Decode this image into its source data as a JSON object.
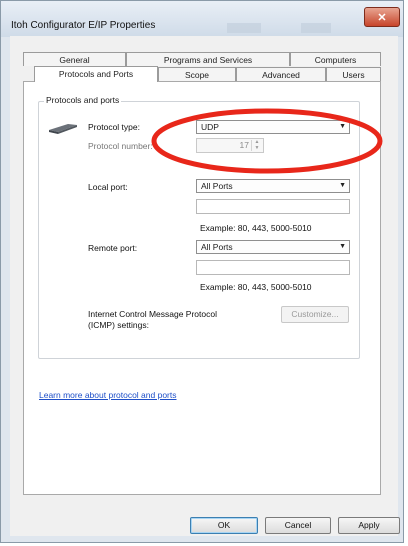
{
  "window": {
    "title": "Itoh Configurator E/IP Properties",
    "close_glyph": "✕",
    "accent_close": "#c7452b"
  },
  "tabs": {
    "row_back": [
      "General",
      "Programs and Services",
      "Computers"
    ],
    "row_front": [
      "Protocols and Ports",
      "Scope",
      "Advanced",
      "Users"
    ],
    "active": "Protocols and Ports"
  },
  "protocols": {
    "group_title": "Protocols and ports",
    "protocol_type_label": "Protocol type:",
    "protocol_type_value": "UDP",
    "protocol_number_label": "Protocol number:",
    "protocol_number_value": "17",
    "local_port_label": "Local port:",
    "local_port_value": "All Ports",
    "local_port_example": "Example: 80, 443, 5000-5010",
    "remote_port_label": "Remote port:",
    "remote_port_value": "All Ports",
    "remote_port_example": "Example: 80, 443, 5000-5010",
    "icmp_label_line1": "Internet Control Message Protocol",
    "icmp_label_line2": "(ICMP) settings:",
    "customize_label": "Customize..."
  },
  "learn_more_link": "Learn more about protocol and ports",
  "buttons": {
    "ok": "OK",
    "cancel": "Cancel",
    "apply": "Apply"
  },
  "icons": {
    "dropdown": "▼",
    "spin_up": "▲",
    "spin_down": "▼"
  },
  "annotation": {
    "color": "#e8271a"
  }
}
